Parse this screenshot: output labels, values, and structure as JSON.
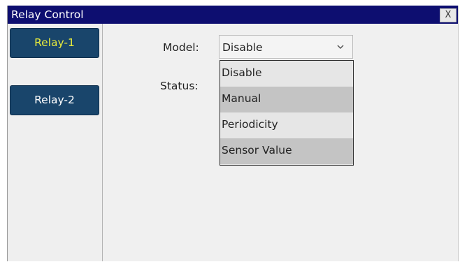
{
  "window": {
    "title": "Relay Control",
    "close_label": "X"
  },
  "sidebar": {
    "items": [
      {
        "label": "Relay-1",
        "active": true
      },
      {
        "label": "Relay-2",
        "active": false
      }
    ]
  },
  "form": {
    "model_label": "Model:",
    "status_label": "Status:",
    "model_select": {
      "value": "Disable",
      "expanded": true,
      "options": [
        "Disable",
        "Manual",
        "Periodicity",
        "Sensor Value"
      ]
    }
  },
  "colors": {
    "titlebar": "#0d0e70",
    "button_bg": "#19456b",
    "active_text": "#e9ec3c",
    "inactive_text": "#ffffff"
  },
  "icons": {
    "close": "close-icon",
    "select_arrow": "chevron-down-icon"
  }
}
